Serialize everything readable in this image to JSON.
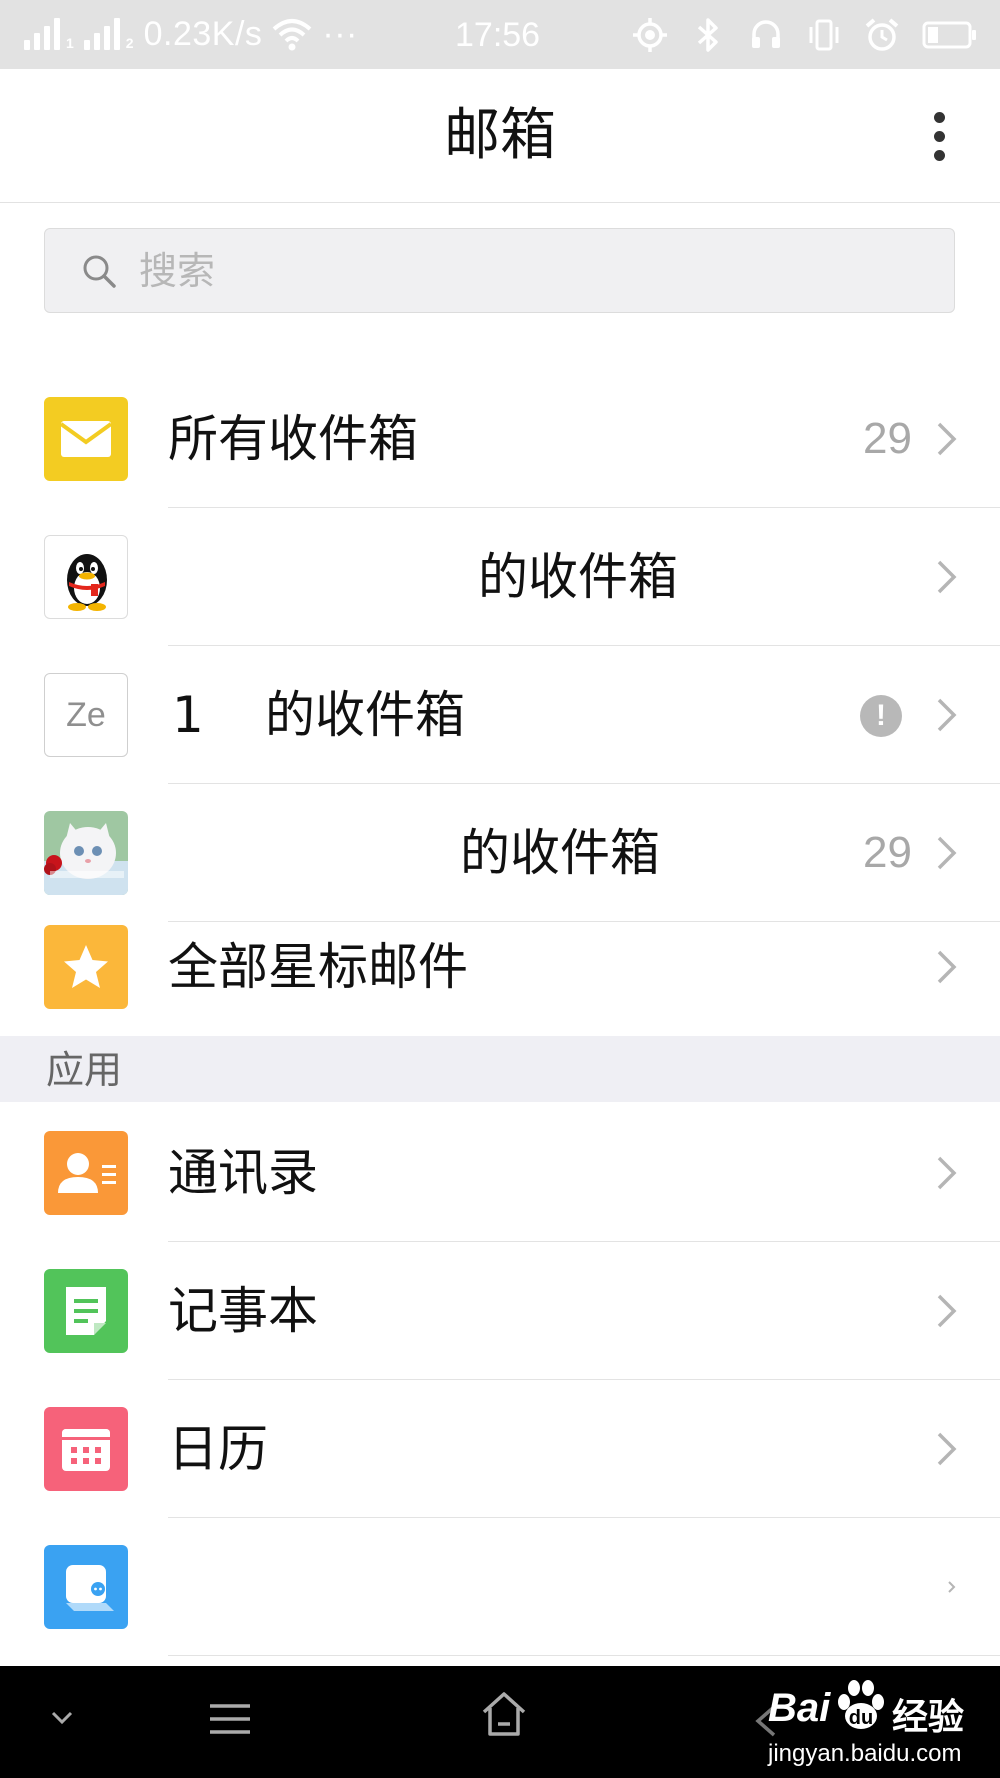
{
  "status_bar": {
    "sim1": "1",
    "sim2": "2",
    "net_speed": "0.23K/s",
    "dots": "···",
    "time": "17:56"
  },
  "header": {
    "title": "邮箱"
  },
  "search": {
    "placeholder": "搜索"
  },
  "mailboxes": [
    {
      "label": "所有收件箱",
      "count": "29",
      "icon": "envelope-icon"
    },
    {
      "label": "的收件箱",
      "count": "",
      "icon": "qq-penguin-icon"
    },
    {
      "label_prefix": "1",
      "label": "的收件箱",
      "count": "",
      "icon_text": "Ze",
      "status_badge": "!"
    },
    {
      "label": "的收件箱",
      "count": "29",
      "icon": "kitten-photo-avatar"
    },
    {
      "label": "全部星标邮件",
      "count": "",
      "icon": "star-icon"
    }
  ],
  "apps_section": {
    "title": "应用",
    "items": [
      {
        "label": "通讯录",
        "icon": "contacts-icon"
      },
      {
        "label": "记事本",
        "icon": "notepad-icon"
      },
      {
        "label": "日历",
        "icon": "calendar-icon"
      },
      {
        "label": "",
        "icon": "chat-icon"
      }
    ]
  },
  "watermark": {
    "brand": "Bai",
    "brand_cn": "经验",
    "url": "jingyan.baidu.com"
  },
  "colors": {
    "envelope": "#f3cc22",
    "star": "#fbb73a",
    "contacts": "#fa9838",
    "notepad": "#52c45a",
    "calendar": "#f6627a",
    "chat": "#3aa2f2"
  }
}
